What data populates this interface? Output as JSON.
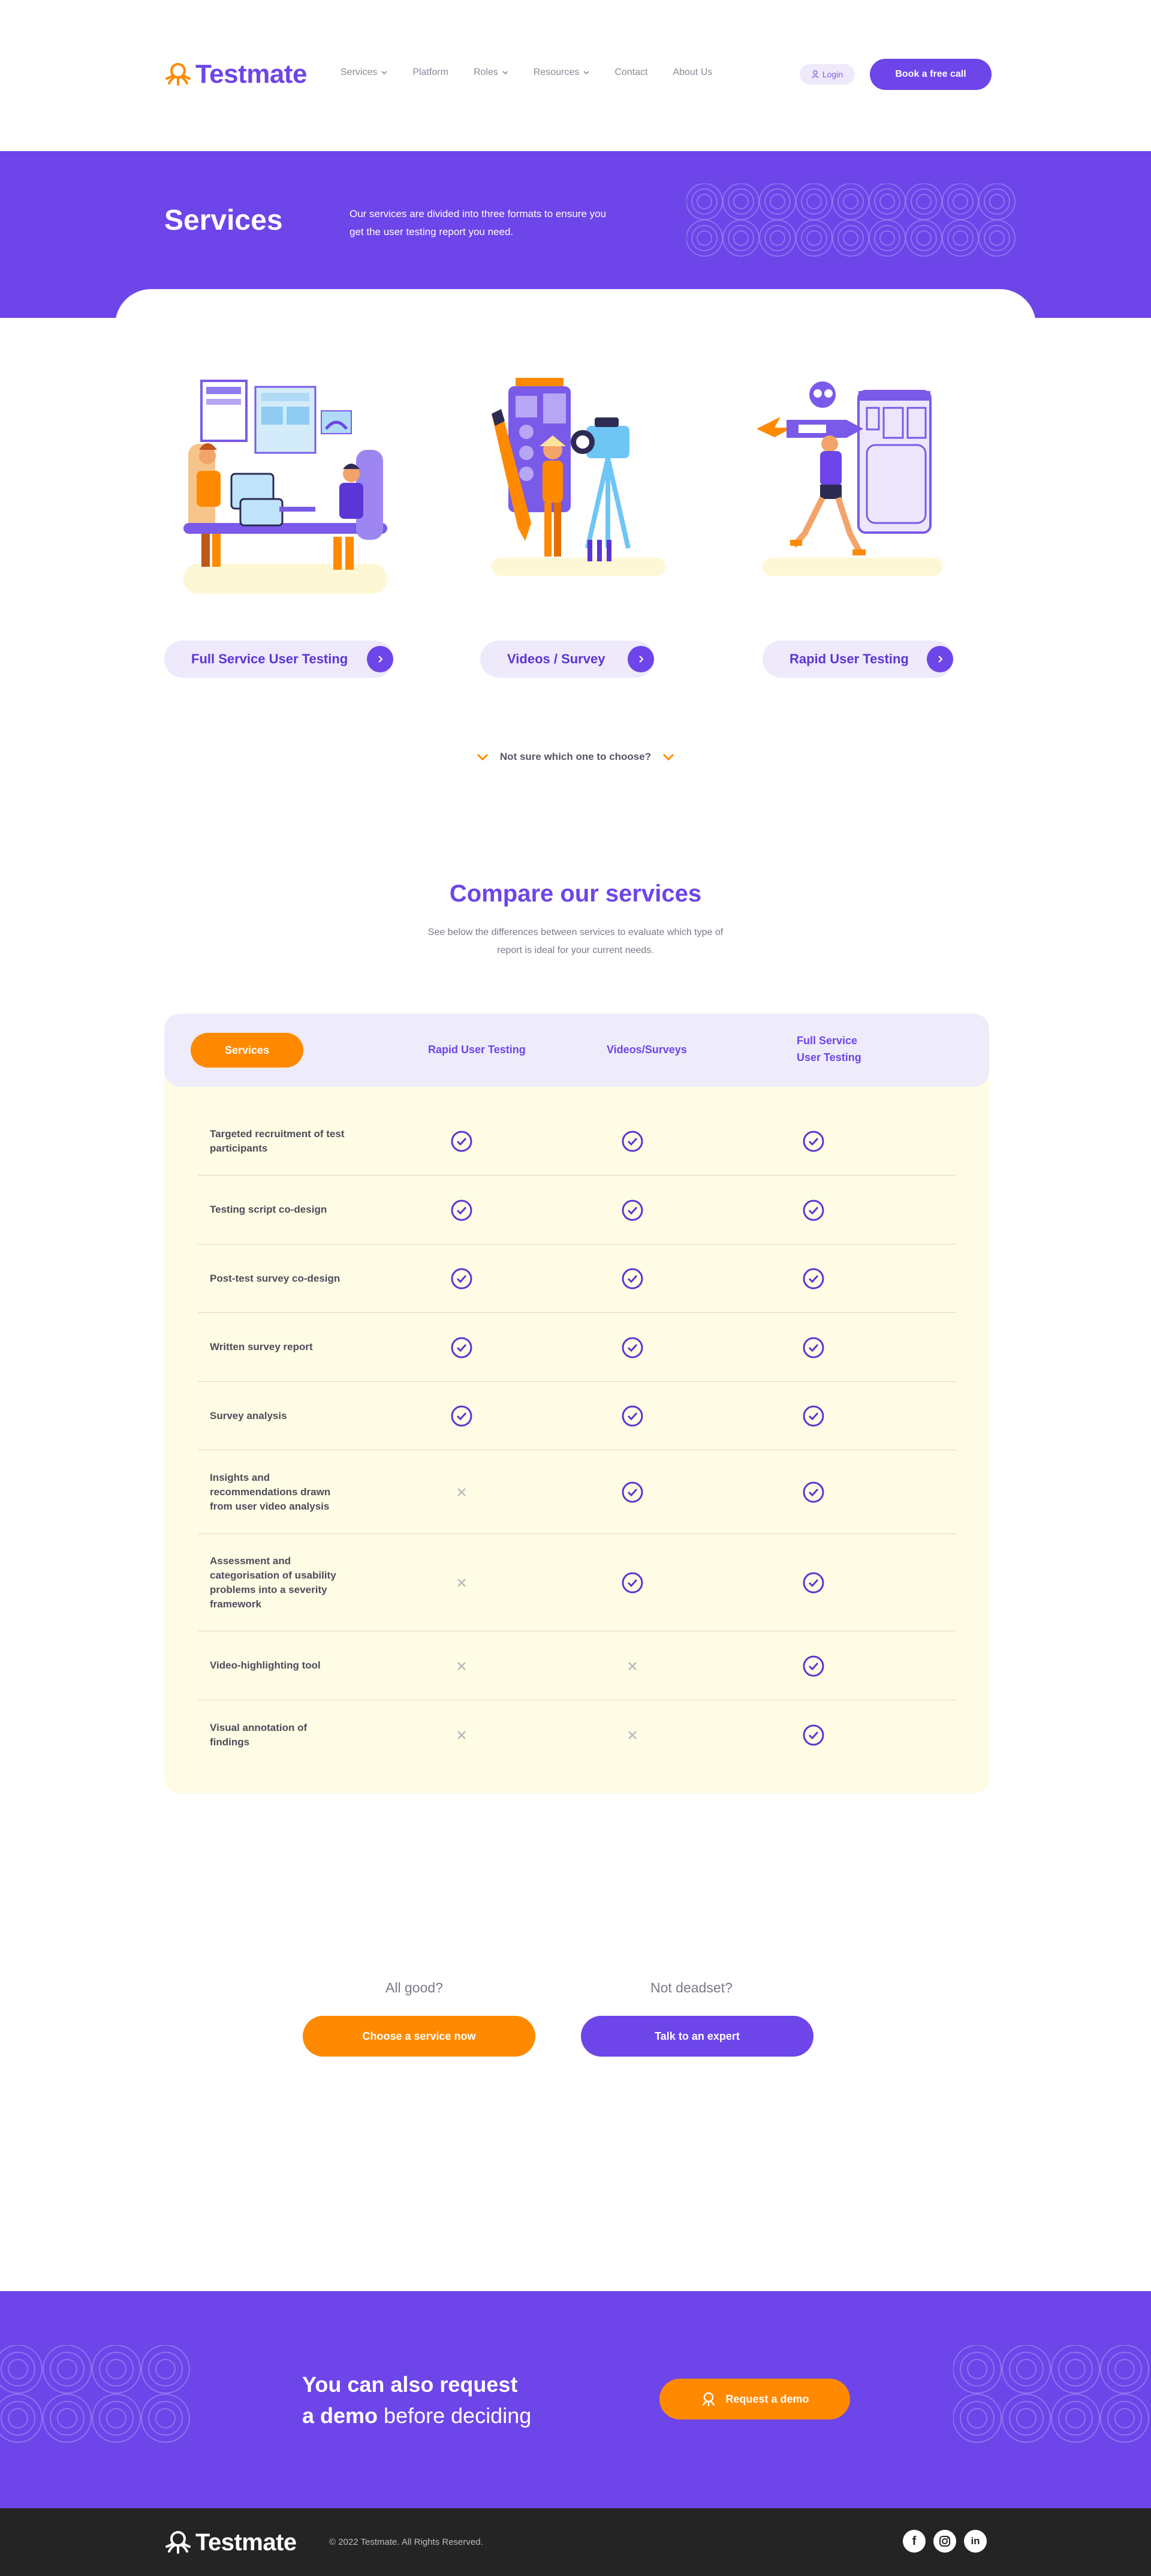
{
  "nav": {
    "brand": "Testmate",
    "links": [
      {
        "label": "Services",
        "has_dropdown": true
      },
      {
        "label": "Platform",
        "has_dropdown": false
      },
      {
        "label": "Roles",
        "has_dropdown": true
      },
      {
        "label": "Resources",
        "has_dropdown": true
      },
      {
        "label": "Contact",
        "has_dropdown": false
      },
      {
        "label": "About Us",
        "has_dropdown": false
      }
    ],
    "login_label": "Login",
    "cta_label": "Book a free call"
  },
  "hero": {
    "title": "Services",
    "description": "Our services are divided into three formats to ensure you get the user testing report you need."
  },
  "services": [
    {
      "label": "Full Service User Testing",
      "illustration": "team-at-desk-illustration"
    },
    {
      "label": "Videos / Survey",
      "illustration": "video-camera-illustration"
    },
    {
      "label": "Rapid User Testing",
      "illustration": "rocket-runner-illustration"
    }
  ],
  "choose_label": "Not sure which one to choose?",
  "compare": {
    "title": "Compare our services",
    "description": "See below the differences between services to evaluate which type of report is ideal for your current needs.",
    "header_pill": "Services",
    "columns": [
      "Rapid User Testing",
      "Videos/Surveys",
      "Full Service User Testing"
    ],
    "rows": [
      {
        "label": "Targeted recruitment of test participants",
        "values": [
          true,
          true,
          true
        ]
      },
      {
        "label": "Testing script co-design",
        "values": [
          true,
          true,
          true
        ]
      },
      {
        "label": "Post-test survey co-design",
        "values": [
          true,
          true,
          true
        ]
      },
      {
        "label": "Written survey report",
        "values": [
          true,
          true,
          true
        ]
      },
      {
        "label": "Survey analysis",
        "values": [
          true,
          true,
          true
        ]
      },
      {
        "label": "Insights and recommendations drawn from user video analysis",
        "values": [
          false,
          true,
          true
        ]
      },
      {
        "label": "Assessment and categorisation of usability problems into a severity framework",
        "values": [
          false,
          true,
          true
        ]
      },
      {
        "label": "Video-highlighting tool",
        "values": [
          false,
          false,
          true
        ]
      },
      {
        "label": "Visual annotation of findings",
        "values": [
          false,
          false,
          true
        ]
      }
    ]
  },
  "bottom_cta": {
    "left_question": "All good?",
    "left_button": "Choose a service now",
    "right_question": "Not deadset?",
    "right_button": "Talk to an expert"
  },
  "banner": {
    "line1_bold": "You can also request",
    "line2_bold": "a demo",
    "line2_rest": " before deciding",
    "button": "Request a demo"
  },
  "footer": {
    "brand": "Testmate",
    "copyright": "© 2022 Testmate. All Rights Reserved.",
    "socials": [
      "facebook-icon",
      "instagram-icon",
      "linkedin-icon"
    ]
  },
  "colors": {
    "brand_purple": "#6d45e8",
    "accent_orange": "#ff8a00",
    "table_body": "#fefce4",
    "table_head": "#eeebfb",
    "footer": "#242424"
  }
}
